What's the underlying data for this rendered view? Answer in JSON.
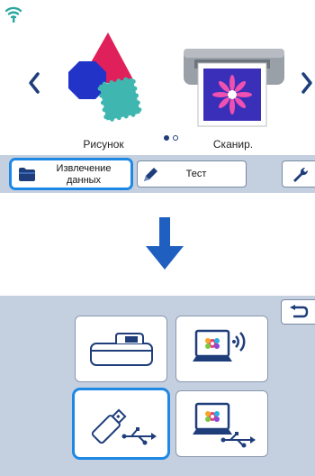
{
  "screen_top": {
    "carousel": {
      "items": [
        {
          "label": "Рисунок",
          "icon": "pattern-shapes-icon"
        },
        {
          "label": "Сканир.",
          "icon": "scanner-icon"
        }
      ],
      "page_dots": {
        "count": 2,
        "active": 1
      }
    },
    "bottom_bar": {
      "extract_label_line1": "Извлечение",
      "extract_label_line2": "данных",
      "test_label": "Тест"
    }
  },
  "screen_bottom": {
    "tiles": [
      {
        "icon": "machine-memory-icon"
      },
      {
        "icon": "wireless-computer-icon"
      },
      {
        "icon": "usb-flash-drive-icon"
      },
      {
        "icon": "usb-computer-icon"
      }
    ]
  },
  "colors": {
    "highlight": "#1e88e5",
    "panel_bg": "#c4d0e0",
    "nav_arrow": "#1e3d7a",
    "down_arrow": "#1e5fbf"
  }
}
